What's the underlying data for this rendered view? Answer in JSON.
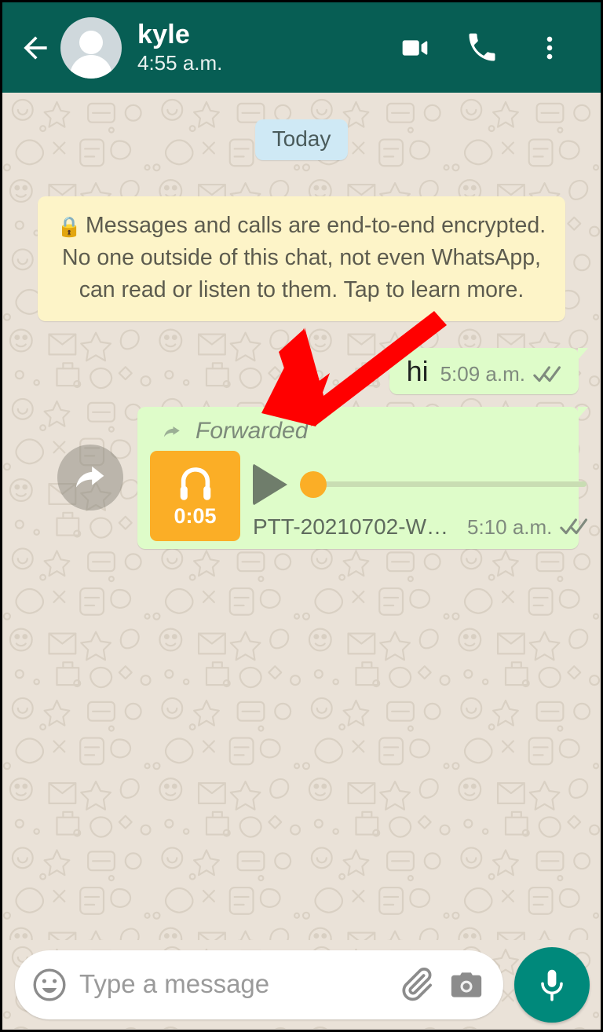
{
  "header": {
    "back_icon": "back-arrow-icon",
    "avatar_icon": "default-person-avatar",
    "contact_name": "kyle",
    "status_time": "4:55 a.m.",
    "video_call_icon": "video-camera-icon",
    "voice_call_icon": "phone-icon",
    "overflow_icon": "three-dots-menu-icon"
  },
  "chat": {
    "date_divider": "Today",
    "encryption_notice": {
      "lock_icon": "lock-icon",
      "text": "Messages and calls are end-to-end encrypted. No one outside of this chat, not even WhatsApp, can read or listen to them. Tap to learn more."
    },
    "messages": [
      {
        "type": "text",
        "body": "hi",
        "time": "5:09 a.m.",
        "status": "read-double-check"
      },
      {
        "type": "audio",
        "forwarded_label": "Forwarded",
        "forward_icon": "forward-arrow-icon",
        "thumbnail_icon": "headphones-icon",
        "duration": "0:05",
        "play_icon": "play-triangle-icon",
        "progress_percent": 0,
        "file_name": "PTT-20210702-W…",
        "time": "5:10 a.m.",
        "status": "read-double-check"
      }
    ],
    "forward_button_icon": "forward-arrow-icon"
  },
  "footer": {
    "emoji_icon": "smiley-face-icon",
    "input_placeholder": "Type a message",
    "attach_icon": "paperclip-icon",
    "camera_icon": "camera-icon",
    "mic_icon": "microphone-icon"
  },
  "annotation": {
    "arrow_icon": "red-pointer-arrow",
    "color": "#FF0000"
  },
  "colors": {
    "header_bg": "#075E54",
    "chat_bg": "#EAE2D8",
    "out_bubble": "#DEFCC9",
    "date_pill": "#CFE9F5",
    "encryption_bg": "#FDF4C8",
    "accent_orange": "#FBAE26",
    "mic_teal": "#00897B"
  }
}
